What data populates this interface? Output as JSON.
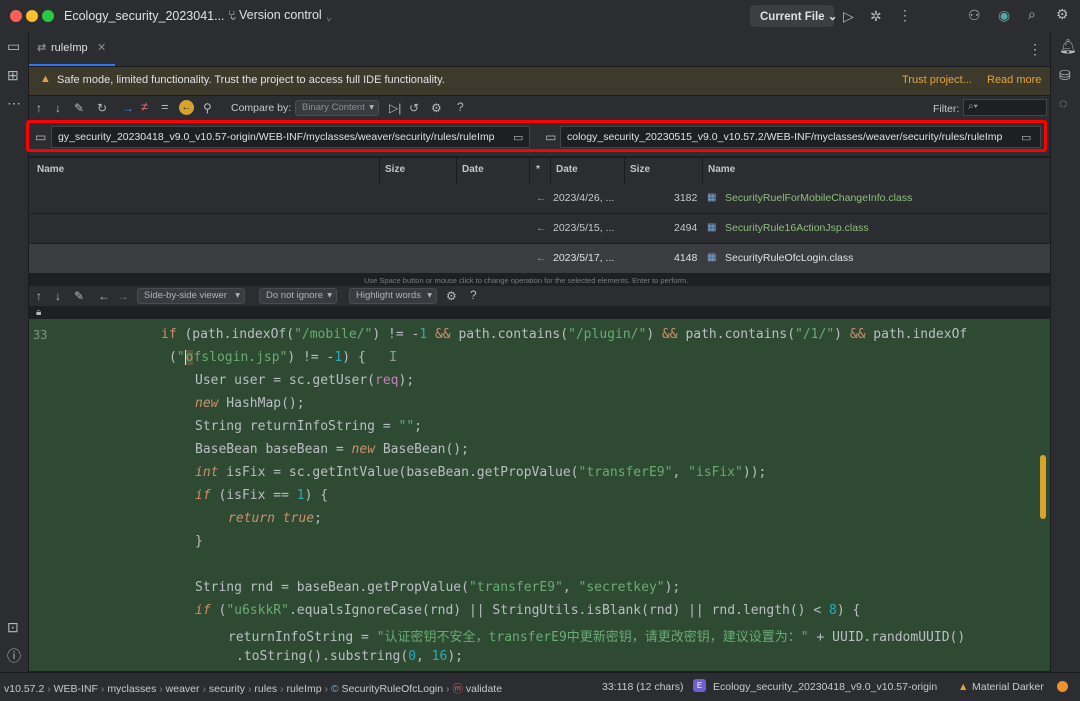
{
  "titlebar": {
    "project": "Ecology_security_2023041...",
    "vcs": "Version control",
    "run_config": "Current File"
  },
  "tab": {
    "label": "ruleImp"
  },
  "banner": {
    "message": "Safe mode, limited functionality. Trust the project to access full IDE functionality.",
    "trust_link": "Trust project...",
    "read_more": "Read more"
  },
  "compare": {
    "label": "Compare by:",
    "mode": "Binary Content",
    "filter_label": "Filter:",
    "filter_placeholder": ""
  },
  "paths": {
    "left": "gy_security_20230418_v9.0_v10.57-origin/WEB-INF/myclasses/weaver/security/rules/ruleImp",
    "right": "cology_security_20230515_v9.0_v10.57.2/WEB-INF/myclasses/weaver/security/rules/ruleImp"
  },
  "table": {
    "headers": {
      "name": "Name",
      "size": "Size",
      "date": "Date",
      "op": "*",
      "date2": "Date",
      "size2": "Size",
      "name2": "Name"
    },
    "rows": [
      {
        "op": "←",
        "date": "2023/4/26, ...",
        "size": "3182",
        "name": "SecurityRuelForMobileChangeInfo.class"
      },
      {
        "op": "←",
        "date": "2023/5/15, ...",
        "size": "2494",
        "name": "SecurityRule16ActionJsp.class"
      },
      {
        "op": "←",
        "date": "2023/5/17, ...",
        "size": "4148",
        "name": "SecurityRuleOfcLogin.class"
      }
    ],
    "hint": "Use Space button or mouse click to change operation for the selected elements. Enter to perform."
  },
  "diff_toolbar": {
    "viewer": "Side-by-side viewer",
    "ignore": "Do not ignore",
    "highlight": "Highlight words"
  },
  "code": {
    "first_line": "33"
  },
  "status": {
    "path": [
      "v10.57.2",
      "WEB-INF",
      "myclasses",
      "weaver",
      "security",
      "rules",
      "ruleImp",
      "SecurityRuleOfcLogin",
      "validate"
    ],
    "position": "33:118 (12 chars)",
    "project": "Ecology_security_20230418_v9.0_v10.57-origin",
    "theme": "Material Darker"
  },
  "colors": {
    "accent": "#3574f0",
    "banner_bg": "#3d3a2b",
    "code_bg": "#2e4a33",
    "highlight_red": "#ff0000",
    "link": "#e6a33e"
  }
}
